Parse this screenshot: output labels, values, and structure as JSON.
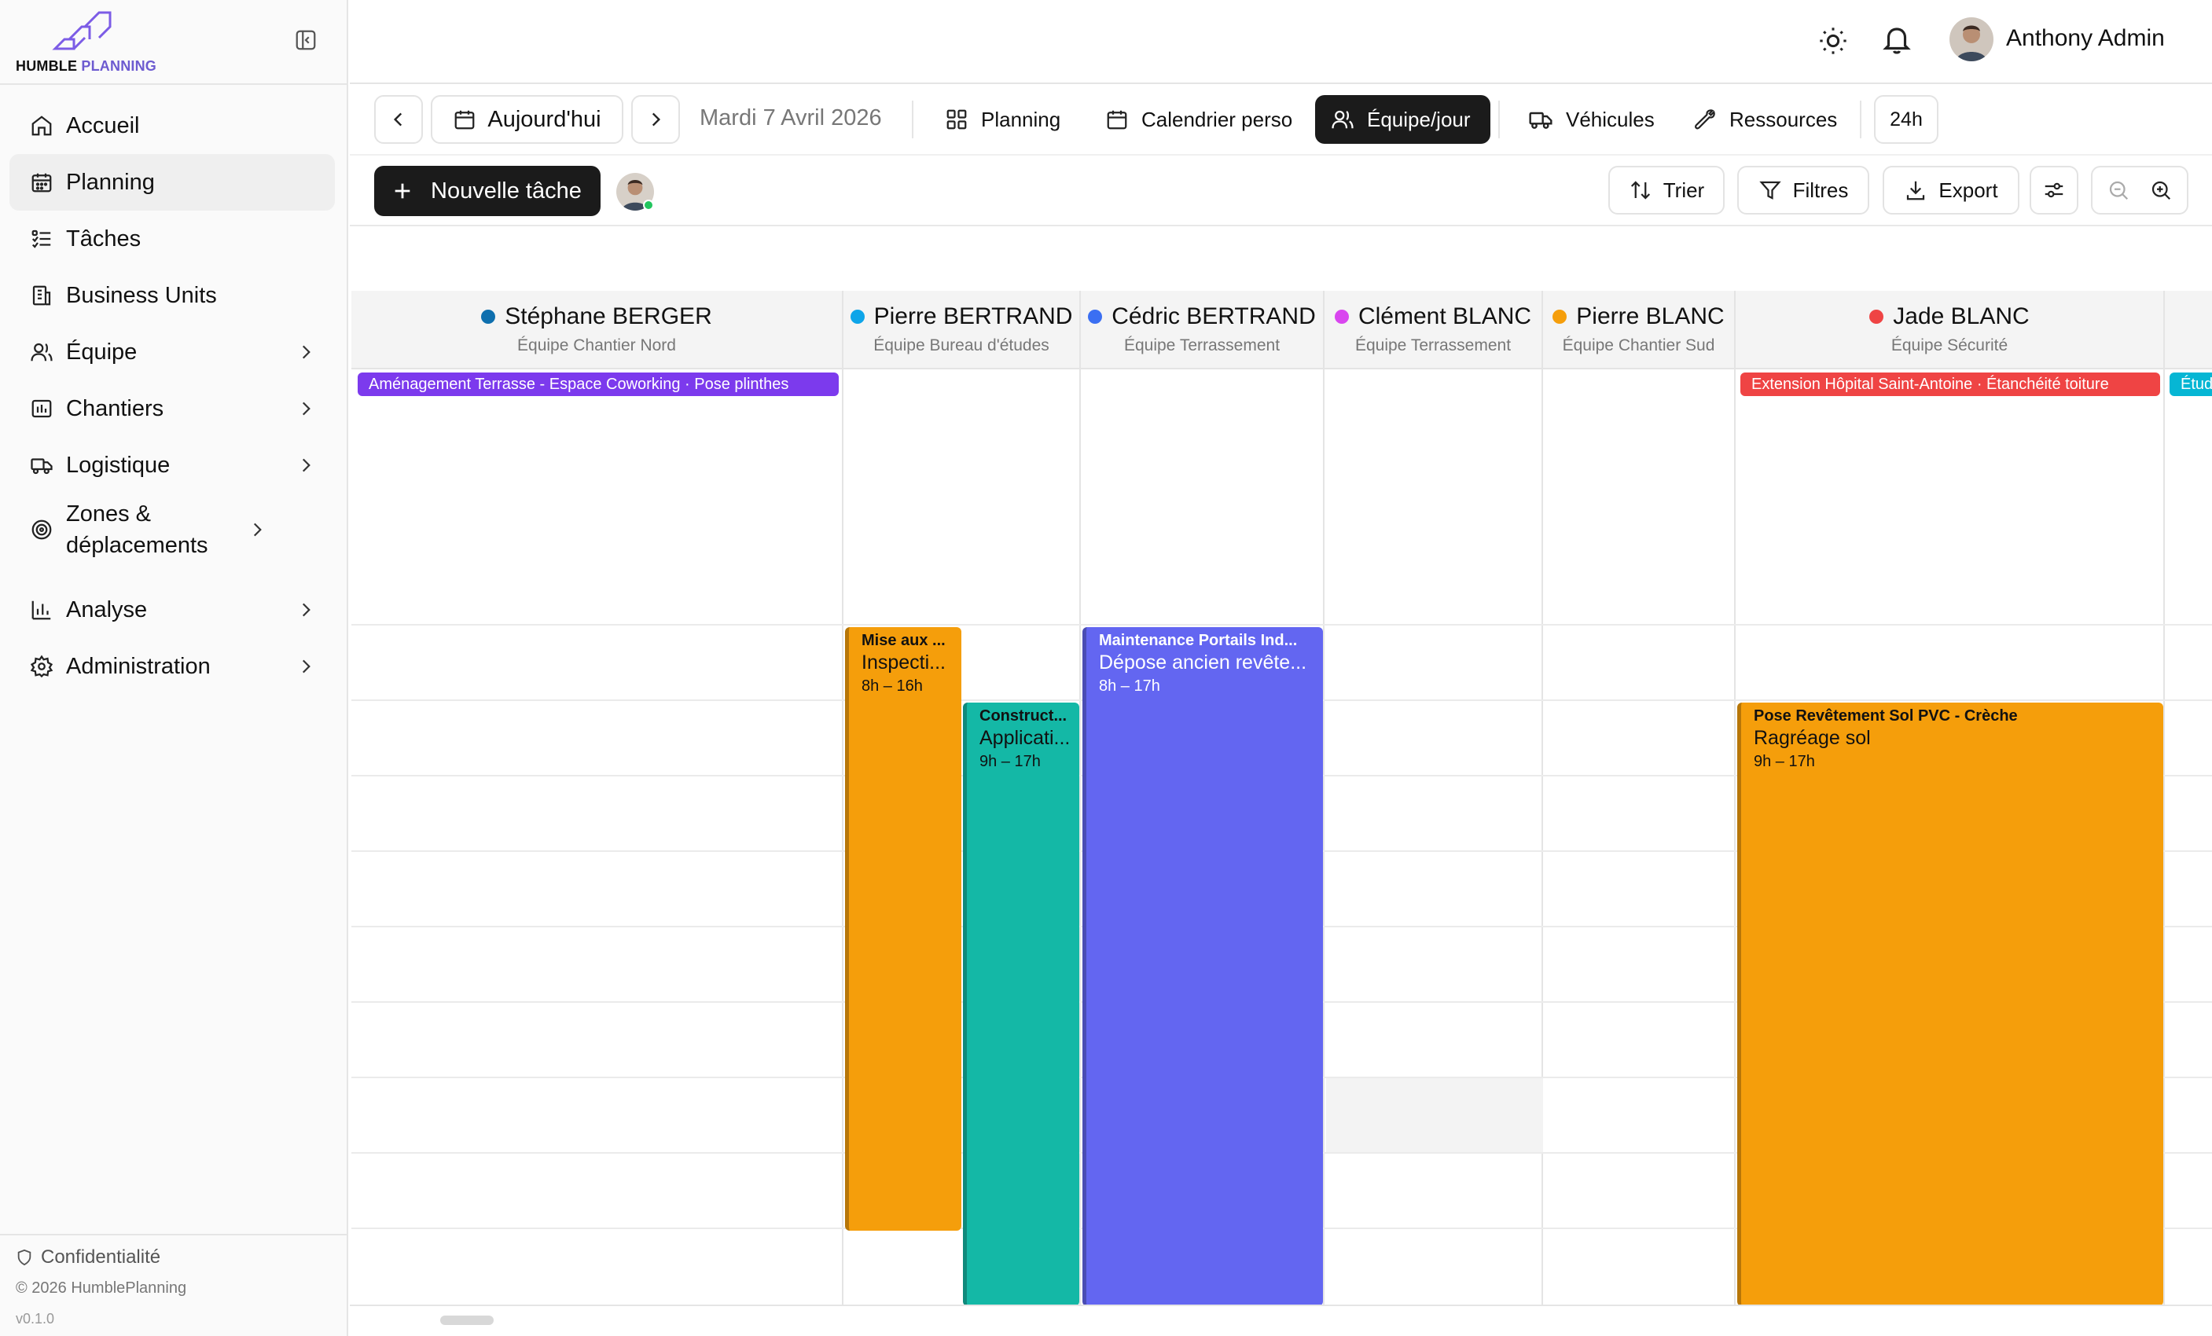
{
  "brand": {
    "name_a": "HUMBLE ",
    "name_b": "PLANNING"
  },
  "sidebar": {
    "items": [
      {
        "label": "Accueil",
        "icon": "home-icon"
      },
      {
        "label": "Planning",
        "icon": "calendar-icon",
        "active": true
      },
      {
        "label": "Tâches",
        "icon": "tasks-list-icon"
      },
      {
        "label": "Business Units",
        "icon": "building-icon"
      },
      {
        "label": "Équipe",
        "icon": "users-icon",
        "chevron": true
      },
      {
        "label": "Chantiers",
        "icon": "site-chart-icon",
        "chevron": true
      },
      {
        "label": "Logistique",
        "icon": "truck-icon",
        "chevron": true
      },
      {
        "label": "Zones & déplacements",
        "icon": "target-icon",
        "chevron": true
      },
      {
        "label": "Analyse",
        "icon": "bar-chart-icon",
        "chevron": true
      },
      {
        "label": "Administration",
        "icon": "gear-icon",
        "chevron": true
      }
    ],
    "footer": {
      "privacy": "Confidentialité",
      "copyright": "© 2026 HumblePlanning",
      "version": "v0.1.0"
    }
  },
  "header": {
    "user_name": "Anthony Admin"
  },
  "toolbar": {
    "today": "Aujourd'hui",
    "date": "Mardi 7 Avril 2026",
    "views": [
      "Planning",
      "Calendrier perso",
      "Équipe/jour",
      "Véhicules",
      "Ressources"
    ],
    "active_view": "Équipe/jour",
    "range": "24h",
    "new_task": "Nouvelle tâche",
    "sort": "Trier",
    "filters": "Filtres",
    "export": "Export"
  },
  "columns": [
    {
      "name": "Stéphane BERGER",
      "team": "Équipe Chantier Nord",
      "color": "#0e6fae"
    },
    {
      "name": "Pierre BERTRAND",
      "team": "Équipe Bureau d'études",
      "color": "#0ea5e9"
    },
    {
      "name": "Cédric BERTRAND",
      "team": "Équipe Terrassement",
      "color": "#3b6ff2"
    },
    {
      "name": "Clément BLANC",
      "team": "Équipe Terrassement",
      "color": "#d946ef"
    },
    {
      "name": "Pierre BLANC",
      "team": "Équipe Chantier Sud",
      "color": "#f59e0b"
    },
    {
      "name": "Jade BLANC",
      "team": "Équipe Sécurité",
      "color": "#ef4444"
    }
  ],
  "all_day": [
    {
      "label": "Aménagement Terrasse - Espace Coworking · Pose plinthes",
      "color": "#7c3aed"
    },
    {
      "label": "Extension Hôpital Saint-Antoine · Étanchéité toiture",
      "color": "#ef4444"
    },
    {
      "label": "Étud",
      "color": "#06b6d4"
    }
  ],
  "events": [
    {
      "project": "Mise aux ...",
      "task": "Inspecti...",
      "time": "8h – 16h",
      "color": "#f59e0b",
      "text_color": "#111"
    },
    {
      "project": "Construct...",
      "task": "Applicati...",
      "time": "9h – 17h",
      "color": "#14b8a6",
      "text_color": "#111"
    },
    {
      "project": "Maintenance Portails Ind...",
      "task": "Dépose ancien revête...",
      "time": "8h – 17h",
      "color": "#6366f1",
      "text_color": "#fff"
    },
    {
      "project": "Pose Revêtement Sol PVC - Crèche",
      "task": "Ragréage sol",
      "time": "9h – 17h",
      "color": "#f59e0b",
      "text_color": "#111"
    }
  ]
}
